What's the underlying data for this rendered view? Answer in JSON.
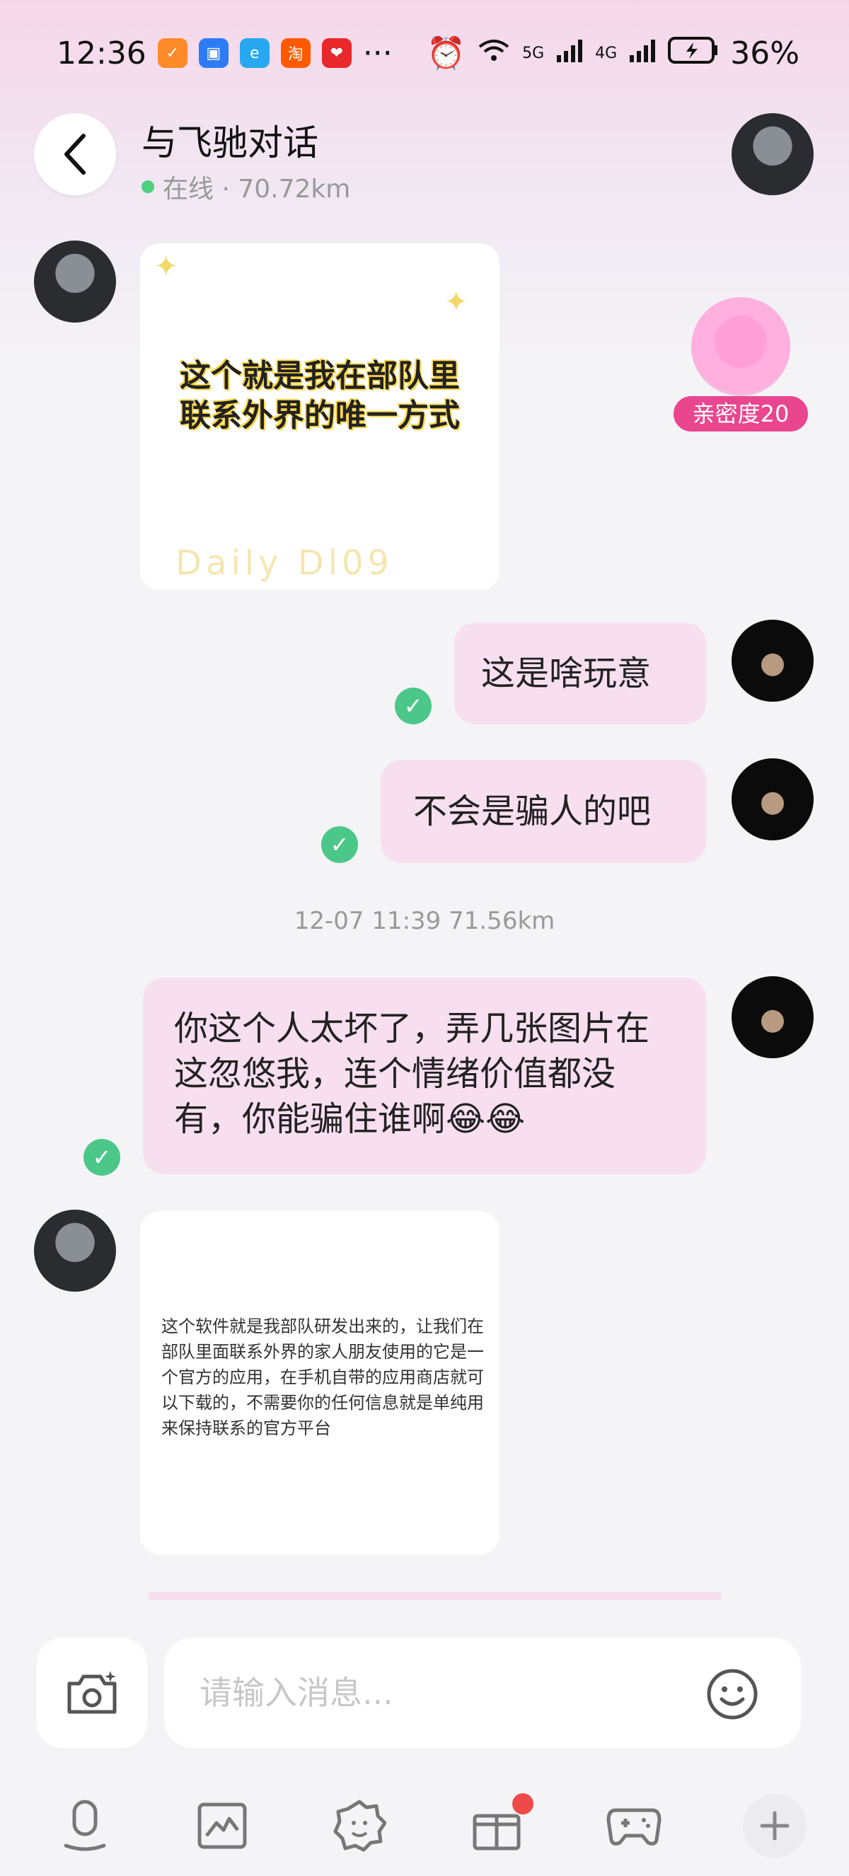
{
  "status_bar": {
    "time": "12:36",
    "battery": "36%",
    "network_a": "5G",
    "network_b": "4G",
    "more": "···"
  },
  "header": {
    "title": "与飞驰对话",
    "status": "在线 · 70.72km"
  },
  "intimacy": {
    "label": "亲密度20"
  },
  "messages": {
    "image1_caption_line1": "这个就是我在部队里",
    "image1_caption_line2": "联系外界的唯一方式",
    "image1_footer": "Daily Dl09",
    "sent1": "这是啥玩意",
    "sent2": "不会是骗人的吧",
    "timestamp": "12-07 11:39  71.56km",
    "sent3": "你这个人太坏了，弄几张图片在这忽悠我，连个情绪价值都没有，你能骗住谁啊😂😂",
    "card_text": "这个软件就是我部队研发出来的，让我们在部队里面联系外界的家人朋友使用的它是一个官方的应用，在手机自带的应用商店就可以下载的，不需要你的任何信息就是单纯用来保持联系的官方平台"
  },
  "input": {
    "placeholder": "请输入消息..."
  },
  "colors": {
    "bubble": "#f7dff0",
    "accent": "#e9468f",
    "online": "#4cd07d",
    "check": "#4cc78a"
  }
}
